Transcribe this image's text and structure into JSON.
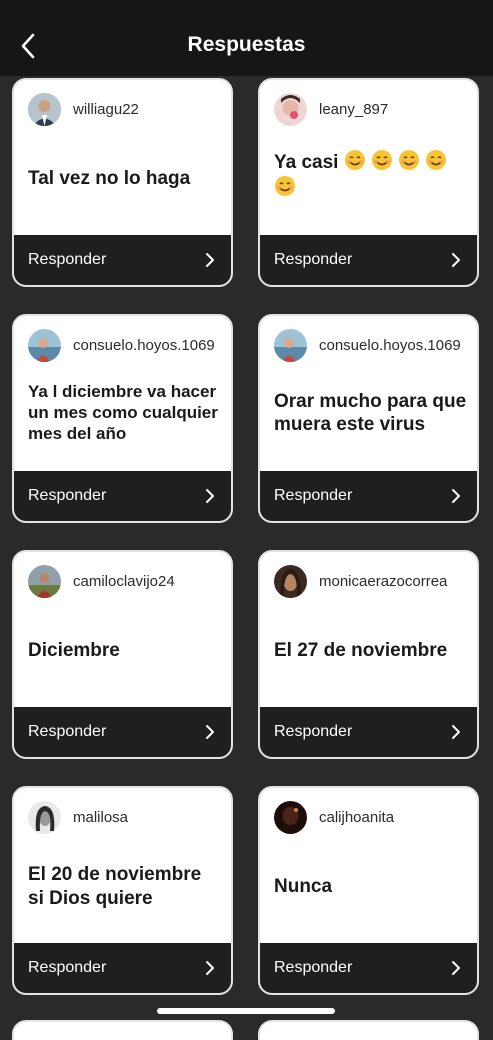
{
  "header": {
    "title": "Respuestas",
    "back_icon": "chevron-left-icon"
  },
  "respond_label": "Responder",
  "cards": [
    {
      "username": "williagu22",
      "answer": "Tal vez no lo haga",
      "avatar_color": "#6b7a8a"
    },
    {
      "username": "leany_897",
      "answer": "Ya casi 😊😊😊😊😊",
      "avatar_color": "#e08aa0"
    },
    {
      "username": "consuelo.hoyos.1069",
      "answer": "Ya l diciembre va hacer un mes como cualquier   mes del año",
      "avatar_color": "#7a9fb5"
    },
    {
      "username": "consuelo.hoyos.1069",
      "answer": "Orar mucho  para que muera este virus",
      "avatar_color": "#7a9fb5"
    },
    {
      "username": "camiloclavijo24",
      "answer": "Diciembre",
      "avatar_color": "#6f7d5a"
    },
    {
      "username": "monicaerazocorrea",
      "answer": "El 27 de noviembre",
      "avatar_color": "#7a5a45"
    },
    {
      "username": "malilosa",
      "answer": "El 20 de noviembre si Dios quiere",
      "avatar_color": "#c8c8c8"
    },
    {
      "username": "calijhoanita",
      "answer": "Nunca",
      "avatar_color": "#3a1a12"
    }
  ]
}
